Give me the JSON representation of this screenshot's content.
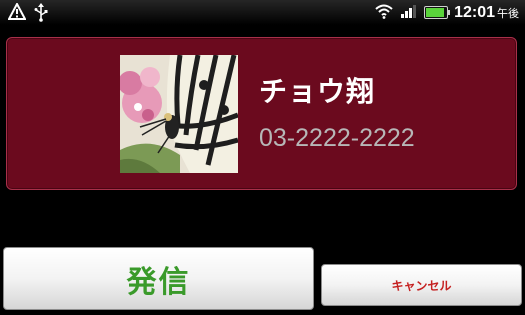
{
  "status_bar": {
    "time": "12:01",
    "time_suffix": "午後",
    "icons": [
      "warning-icon",
      "usb-icon",
      "wifi-icon",
      "signal-icon",
      "battery-icon"
    ],
    "battery_level": 0.9
  },
  "contact": {
    "name": "チョウ翔",
    "number": "03-2222-2222",
    "photo": "butterfly-photo"
  },
  "actions": {
    "call_label": "発信",
    "cancel_label": "キャンセル"
  },
  "colors": {
    "card_background": "#6b0a1e",
    "call_text": "#3a9a2a",
    "cancel_text": "#c52020"
  }
}
